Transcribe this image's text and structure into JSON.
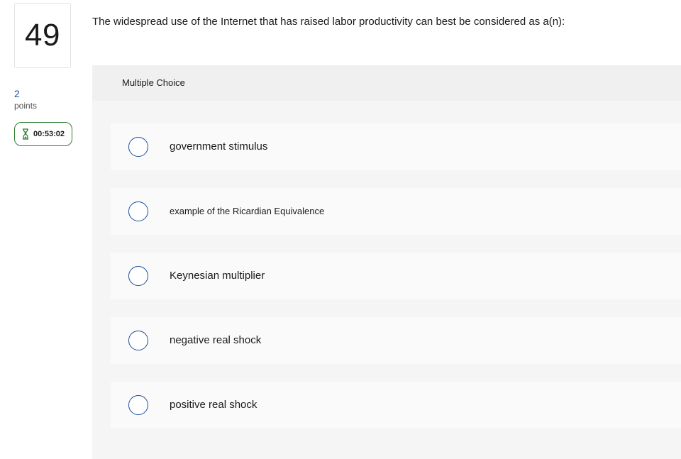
{
  "question": {
    "number": "49",
    "points_value": "2",
    "points_label": "points",
    "timer": "00:53:02",
    "timer_icon": "hourglass-icon",
    "text": "The widespread use of the Internet that has raised labor productivity can best be considered as a(n):"
  },
  "answer_panel": {
    "title": "Multiple Choice",
    "options": [
      {
        "label": "government stimulus"
      },
      {
        "label": "example of the Ricardian Equivalence"
      },
      {
        "label": "Keynesian multiplier"
      },
      {
        "label": "negative real shock"
      },
      {
        "label": "positive real shock"
      }
    ]
  },
  "colors": {
    "accent_blue": "#1c4f9c",
    "timer_green": "#2e7d32",
    "panel_bg": "#f5f5f5"
  }
}
